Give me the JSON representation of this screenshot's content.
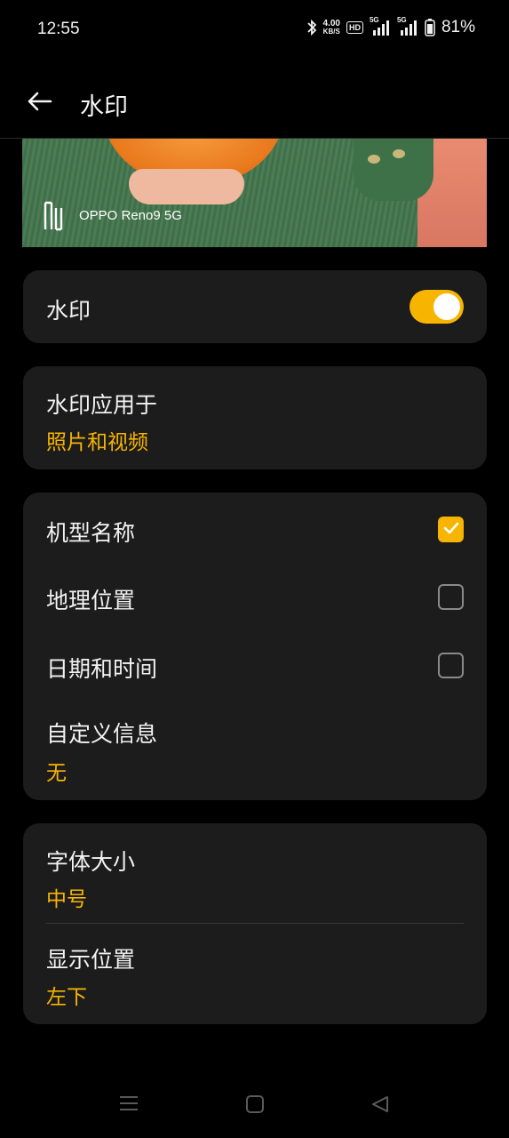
{
  "status_bar": {
    "time": "12:55",
    "net_speed_value": "4.00",
    "net_speed_unit": "KB/S",
    "hd_badge": "HD",
    "signal1_tag": "5G",
    "signal2_tag": "5G",
    "battery_percent": "81%"
  },
  "app_bar": {
    "title": "水印",
    "back_icon": "arrow-left-icon"
  },
  "preview": {
    "watermark_text": "OPPO Reno9 5G"
  },
  "watermark_toggle": {
    "label": "水印",
    "enabled": true
  },
  "apply_to": {
    "label": "水印应用于",
    "value": "照片和视频"
  },
  "info_options": {
    "model_name": {
      "label": "机型名称",
      "checked": true
    },
    "location": {
      "label": "地理位置",
      "checked": false
    },
    "date_time": {
      "label": "日期和时间",
      "checked": false
    },
    "custom_info": {
      "label": "自定义信息",
      "value": "无"
    }
  },
  "style": {
    "font_size_label": "字体大小",
    "font_size_value": "中号",
    "position_label": "显示位置",
    "position_value": "左下"
  },
  "colors": {
    "accent": "#f7b500",
    "card_bg": "#1c1c1c",
    "page_bg": "#000000"
  },
  "nav_bar": {
    "menu_icon": "menu-icon",
    "home_icon": "home-square-icon",
    "back_icon": "back-triangle-icon"
  }
}
